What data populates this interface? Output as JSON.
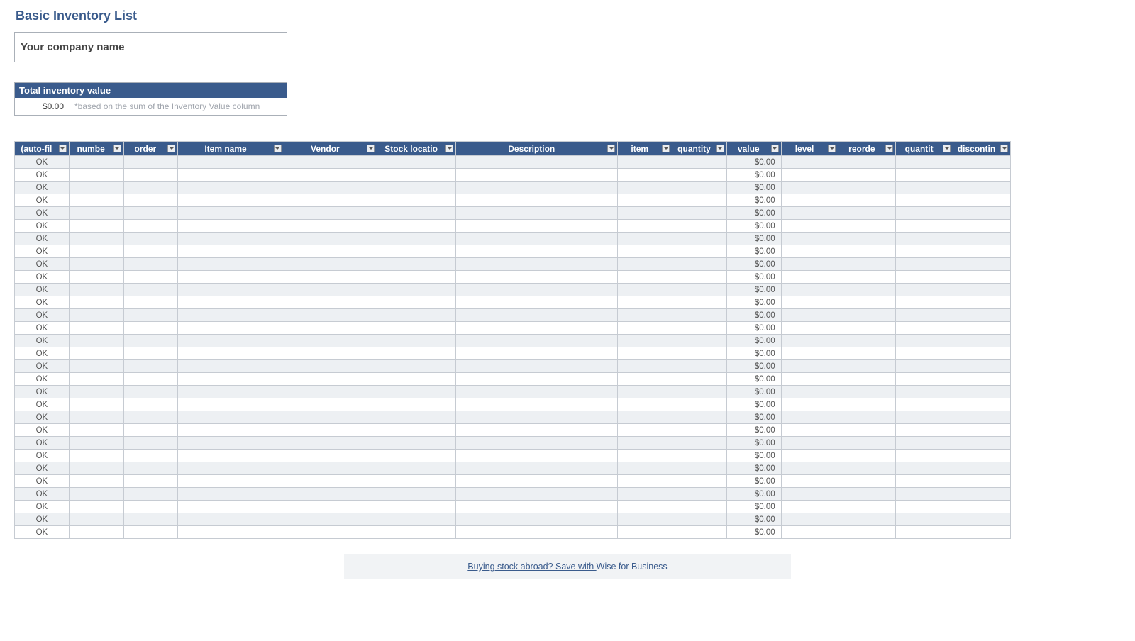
{
  "title": "Basic Inventory List",
  "company_placeholder": "Your company name",
  "total_inventory": {
    "label": "Total inventory value",
    "value": "$0.00",
    "note": "*based on the sum of the Inventory Value column"
  },
  "columns": [
    {
      "key": "auto",
      "label": "(auto-fil"
    },
    {
      "key": "number",
      "label": "numbe"
    },
    {
      "key": "order",
      "label": "order"
    },
    {
      "key": "item",
      "label": "Item name"
    },
    {
      "key": "vendor",
      "label": "Vendor"
    },
    {
      "key": "stock",
      "label": "Stock locatio"
    },
    {
      "key": "desc",
      "label": "Description"
    },
    {
      "key": "itm",
      "label": "item"
    },
    {
      "key": "qty",
      "label": "quantity"
    },
    {
      "key": "value",
      "label": "value"
    },
    {
      "key": "level",
      "label": "level"
    },
    {
      "key": "reorder",
      "label": "reorde"
    },
    {
      "key": "quant2",
      "label": "quantit"
    },
    {
      "key": "disc",
      "label": "discontin"
    }
  ],
  "row_defaults": {
    "status": "OK",
    "value": "$0.00"
  },
  "row_count": 30,
  "footer": {
    "lead": "Buying stock abroad? Save with ",
    "link": "Wise for Business"
  }
}
